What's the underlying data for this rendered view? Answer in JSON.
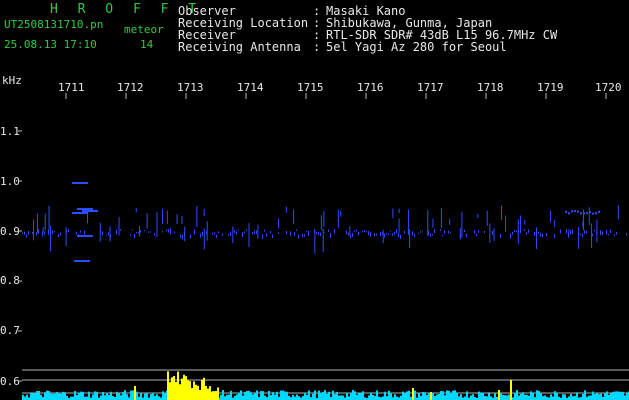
{
  "header": {
    "title": "H R O F F T",
    "filename": "UT2508131710.pn",
    "mode": "meteor",
    "datetime": "25.08.13 17:10",
    "count": "14",
    "rows": [
      {
        "label": "Observer",
        "value": "Masaki Kano"
      },
      {
        "label": "Receiving Location",
        "value": "Shibukawa, Gunma, Japan"
      },
      {
        "label": "Receiver",
        "value": "RTL-SDR SDR# 43dB L15 96.7MHz CW"
      },
      {
        "label": "Receiving Antenna",
        "value": "5el Yagi Az 280 for Seoul"
      }
    ]
  },
  "axis": {
    "unit": "kHz",
    "time_ticks": [
      "1711",
      "1712",
      "1713",
      "1714",
      "1715",
      "1716",
      "1717",
      "1718",
      "1719",
      "1720"
    ],
    "freq_ticks": [
      "1.1",
      "1.0",
      "0.9",
      "0.8",
      "0.7",
      "0.6"
    ]
  },
  "colors": {
    "text_green": "#2ecc40",
    "text_white": "#e8e8e8",
    "signal_blue": "#2a4dff",
    "signal_cyan": "#00d8ff",
    "signal_red": "#ff2a4a",
    "signal_yellow": "#ffff00",
    "signal_green": "#00ff66"
  }
}
